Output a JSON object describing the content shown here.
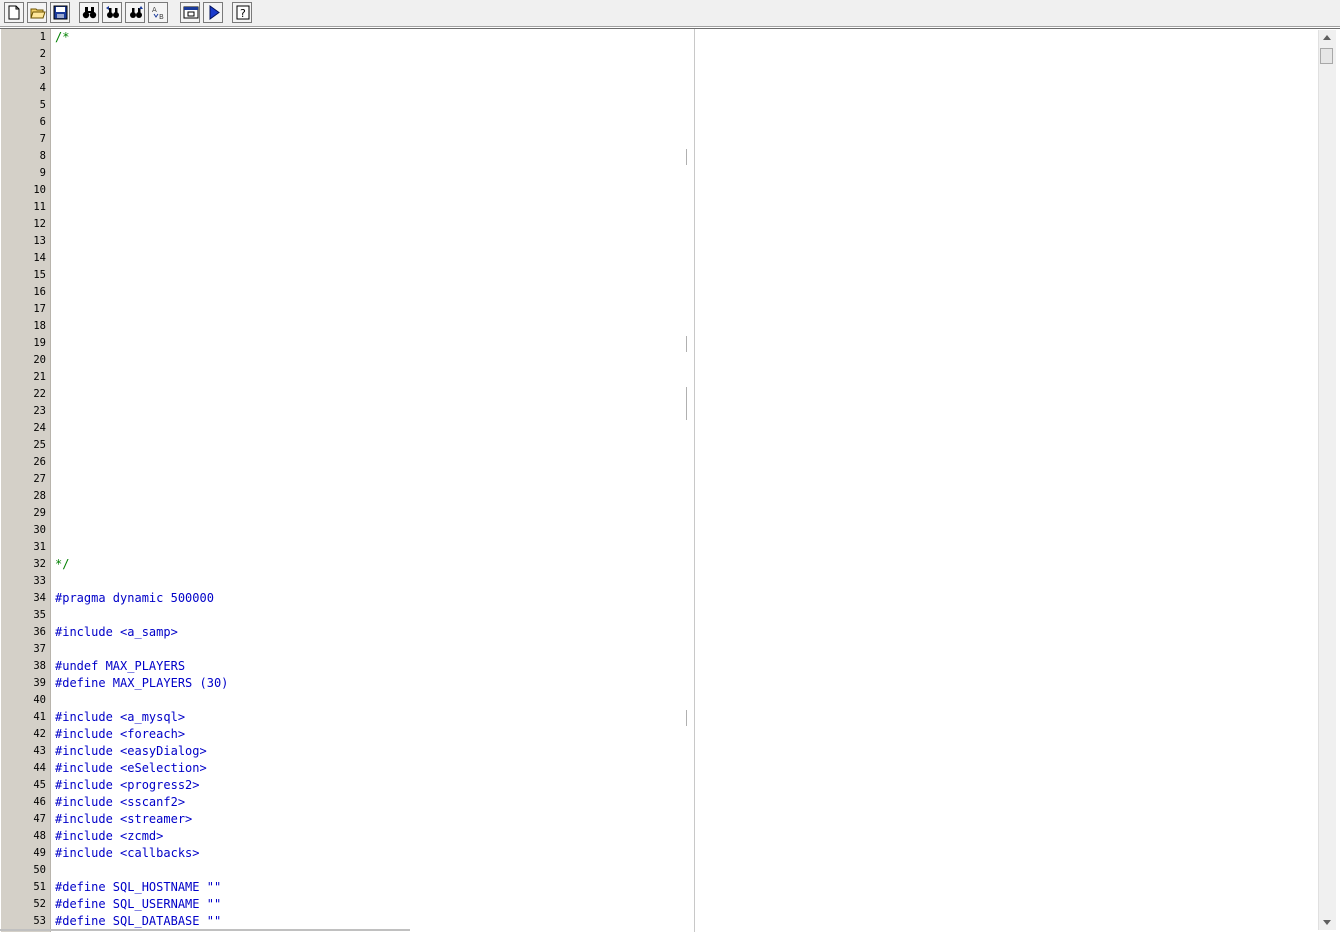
{
  "toolbar": {
    "buttons": [
      {
        "name": "new-file-icon"
      },
      {
        "name": "open-folder-icon"
      },
      {
        "name": "save-disk-icon"
      },
      {
        "name": "find-binoculars-icon"
      },
      {
        "name": "find-next-icon"
      },
      {
        "name": "replace-icon"
      },
      {
        "name": "replace-ab-icon"
      },
      {
        "name": "compile-window-icon"
      },
      {
        "name": "run-play-icon"
      },
      {
        "name": "help-icon"
      }
    ]
  },
  "editor": {
    "lines": [
      {
        "n": "1",
        "text": "/*",
        "kind": "comment"
      },
      {
        "n": "2",
        "text": "",
        "kind": "comment"
      },
      {
        "n": "3",
        "text": "",
        "kind": "comment"
      },
      {
        "n": "4",
        "text": "",
        "kind": "comment"
      },
      {
        "n": "5",
        "text": "",
        "kind": "comment"
      },
      {
        "n": "6",
        "text": "",
        "kind": "comment"
      },
      {
        "n": "7",
        "text": "",
        "kind": "comment"
      },
      {
        "n": "8",
        "text": "",
        "kind": "comment"
      },
      {
        "n": "9",
        "text": "",
        "kind": "comment"
      },
      {
        "n": "10",
        "text": "",
        "kind": "comment"
      },
      {
        "n": "11",
        "text": "",
        "kind": "comment"
      },
      {
        "n": "12",
        "text": "",
        "kind": "comment"
      },
      {
        "n": "13",
        "text": "",
        "kind": "comment"
      },
      {
        "n": "14",
        "text": "",
        "kind": "comment"
      },
      {
        "n": "15",
        "text": "",
        "kind": "comment"
      },
      {
        "n": "16",
        "text": "",
        "kind": "comment"
      },
      {
        "n": "17",
        "text": "",
        "kind": "comment"
      },
      {
        "n": "18",
        "text": "",
        "kind": "comment"
      },
      {
        "n": "19",
        "text": "",
        "kind": "comment"
      },
      {
        "n": "20",
        "text": "",
        "kind": "comment"
      },
      {
        "n": "21",
        "text": "",
        "kind": "comment"
      },
      {
        "n": "22",
        "text": "",
        "kind": "comment"
      },
      {
        "n": "23",
        "text": "",
        "kind": "comment"
      },
      {
        "n": "24",
        "text": "",
        "kind": "comment"
      },
      {
        "n": "25",
        "text": "",
        "kind": "comment"
      },
      {
        "n": "26",
        "text": "",
        "kind": "comment"
      },
      {
        "n": "27",
        "text": "",
        "kind": "comment"
      },
      {
        "n": "28",
        "text": "",
        "kind": "comment"
      },
      {
        "n": "29",
        "text": "",
        "kind": "comment"
      },
      {
        "n": "30",
        "text": "",
        "kind": "comment"
      },
      {
        "n": "31",
        "text": "",
        "kind": "comment"
      },
      {
        "n": "32",
        "text": "*/",
        "kind": "comment"
      },
      {
        "n": "33",
        "text": "",
        "kind": "code"
      },
      {
        "n": "34",
        "text": "#pragma dynamic 500000",
        "kind": "code"
      },
      {
        "n": "35",
        "text": "",
        "kind": "code"
      },
      {
        "n": "36",
        "text": "#include <a_samp>",
        "kind": "code"
      },
      {
        "n": "37",
        "text": "",
        "kind": "code"
      },
      {
        "n": "38",
        "text": "#undef MAX_PLAYERS",
        "kind": "code"
      },
      {
        "n": "39",
        "text": "#define MAX_PLAYERS (30)",
        "kind": "code"
      },
      {
        "n": "40",
        "text": "",
        "kind": "code"
      },
      {
        "n": "41",
        "text": "#include <a_mysql>",
        "kind": "code"
      },
      {
        "n": "42",
        "text": "#include <foreach>",
        "kind": "code"
      },
      {
        "n": "43",
        "text": "#include <easyDialog>",
        "kind": "code"
      },
      {
        "n": "44",
        "text": "#include <eSelection>",
        "kind": "code"
      },
      {
        "n": "45",
        "text": "#include <progress2>",
        "kind": "code"
      },
      {
        "n": "46",
        "text": "#include <sscanf2>",
        "kind": "code"
      },
      {
        "n": "47",
        "text": "#include <streamer>",
        "kind": "code"
      },
      {
        "n": "48",
        "text": "#include <zcmd>",
        "kind": "code"
      },
      {
        "n": "49",
        "text": "#include <callbacks>",
        "kind": "code"
      },
      {
        "n": "50",
        "text": "",
        "kind": "code"
      },
      {
        "n": "51",
        "text": "#define SQL_HOSTNAME \"\"",
        "kind": "code"
      },
      {
        "n": "52",
        "text": "#define SQL_USERNAME \"\"",
        "kind": "code"
      },
      {
        "n": "53",
        "text": "#define SQL_DATABASE \"\"",
        "kind": "code"
      }
    ]
  }
}
